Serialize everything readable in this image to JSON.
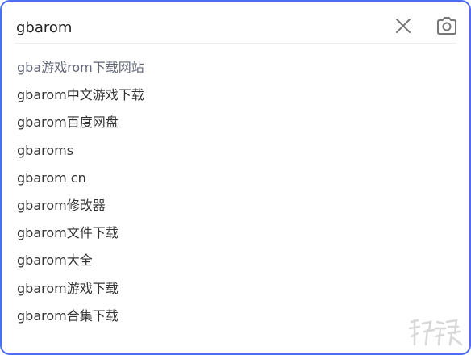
{
  "search": {
    "query": "gbarom",
    "clear_icon": "close-icon",
    "camera_icon": "camera-icon"
  },
  "suggestions": [
    "gba游戏rom下载网站",
    "gbarom中文游戏下载",
    "gbarom百度网盘",
    "gbaroms",
    "gbarom cn",
    "gbarom修改器",
    "gbarom文件下载",
    "gbarom大全",
    "gbarom游戏下载",
    "gbarom合集下载"
  ],
  "watermark": {
    "text": "游侠网"
  },
  "colors": {
    "border": "#4e6ef2",
    "text": "#333333",
    "icon": "#777777"
  }
}
